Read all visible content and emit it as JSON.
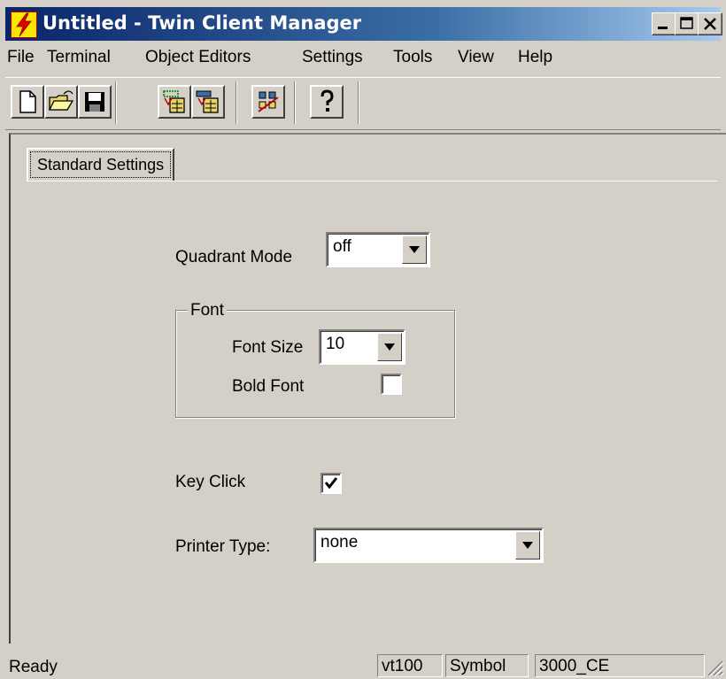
{
  "window": {
    "title": "Untitled - Twin Client Manager",
    "icon": "lightning-app-icon",
    "controls": [
      "minimize-icon",
      "maximize-icon",
      "close-icon"
    ]
  },
  "menu": {
    "items": [
      "File",
      "Terminal",
      "Object Editors",
      "Settings",
      "Tools",
      "View",
      "Help"
    ]
  },
  "toolbar": {
    "buttons": [
      "new-document-icon",
      "open-folder-icon",
      "save-disk-icon",
      "import-icon",
      "export-icon",
      "layout-icon",
      "help-icon"
    ]
  },
  "tabs": [
    {
      "label": "Standard Settings",
      "active": true
    }
  ],
  "settings": {
    "quadrant_mode": {
      "label": "Quadrant Mode",
      "value": "off"
    },
    "font_group": {
      "title": "Font",
      "font_size": {
        "label": "Font Size",
        "value": "10"
      },
      "bold_font": {
        "label": "Bold Font",
        "checked": false
      }
    },
    "key_click": {
      "label": "Key Click",
      "checked": true
    },
    "printer_type": {
      "label": "Printer Type:",
      "value": "none"
    }
  },
  "status": {
    "message": "Ready",
    "panes": [
      "vt100",
      "Symbol",
      "3000_CE"
    ]
  },
  "colors": {
    "face": "#d4d0c8",
    "title_start": "#0a246a",
    "title_end": "#a6caf0",
    "icon_yellow": "#ffe600",
    "icon_red": "#c00000"
  }
}
